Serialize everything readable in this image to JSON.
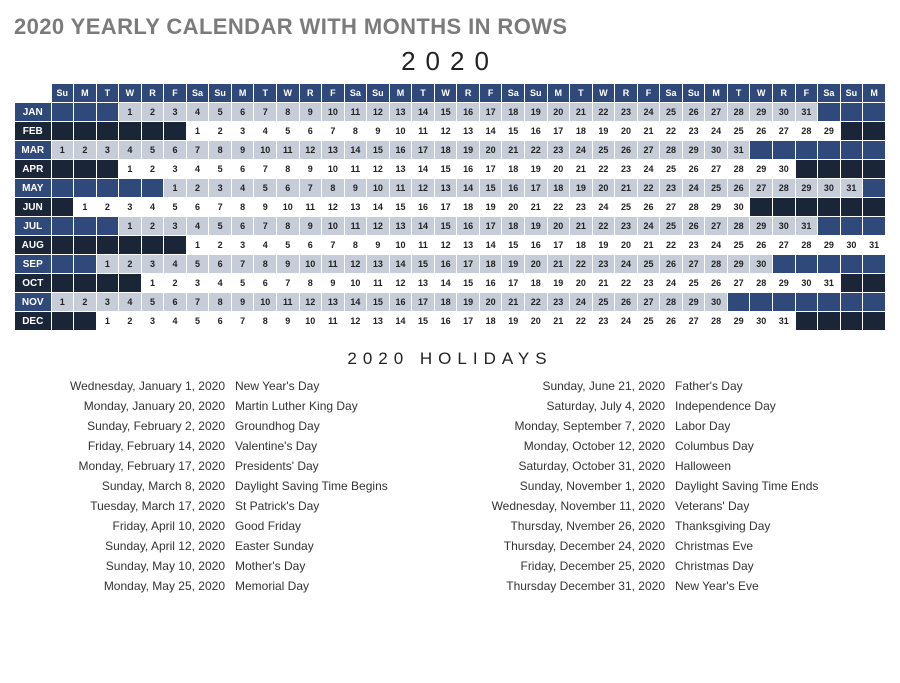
{
  "title": "2020 YEARLY CALENDAR WITH MONTHS IN ROWS",
  "year": "2020",
  "holidays_heading": "2020 HOLIDAYS",
  "dow": [
    "Su",
    "M",
    "T",
    "W",
    "R",
    "F",
    "Sa",
    "Su",
    "M",
    "T",
    "W",
    "R",
    "F",
    "Sa",
    "Su",
    "M",
    "T",
    "W",
    "R",
    "F",
    "Sa",
    "Su",
    "M",
    "T",
    "W",
    "R",
    "F",
    "Sa",
    "Su",
    "M",
    "T",
    "W",
    "R",
    "F",
    "Sa",
    "Su",
    "M"
  ],
  "months": [
    {
      "label": "JAN",
      "start": 3,
      "days": 31
    },
    {
      "label": "FEB",
      "start": 6,
      "days": 29
    },
    {
      "label": "MAR",
      "start": 0,
      "days": 31
    },
    {
      "label": "APR",
      "start": 3,
      "days": 30
    },
    {
      "label": "MAY",
      "start": 5,
      "days": 31
    },
    {
      "label": "JUN",
      "start": 1,
      "days": 30
    },
    {
      "label": "JUL",
      "start": 3,
      "days": 31
    },
    {
      "label": "AUG",
      "start": 6,
      "days": 31
    },
    {
      "label": "SEP",
      "start": 2,
      "days": 30
    },
    {
      "label": "OCT",
      "start": 4,
      "days": 31
    },
    {
      "label": "NOV",
      "start": 0,
      "days": 30
    },
    {
      "label": "DEC",
      "start": 2,
      "days": 31
    }
  ],
  "holidays_left": [
    {
      "date": "Wednesday, January 1, 2020",
      "name": "New Year's Day"
    },
    {
      "date": "Monday, January 20, 2020",
      "name": "Martin Luther King Day"
    },
    {
      "date": "Sunday, February 2, 2020",
      "name": "Groundhog Day"
    },
    {
      "date": "Friday, February 14, 2020",
      "name": "Valentine's Day"
    },
    {
      "date": "Monday, February 17, 2020",
      "name": "Presidents' Day"
    },
    {
      "date": "Sunday, March 8, 2020",
      "name": "Daylight Saving Time Begins"
    },
    {
      "date": "Tuesday, March 17, 2020",
      "name": "St Patrick's Day"
    },
    {
      "date": "Friday, April 10, 2020",
      "name": "Good Friday"
    },
    {
      "date": "Sunday, April 12, 2020",
      "name": "Easter Sunday"
    },
    {
      "date": "Sunday, May 10, 2020",
      "name": "Mother's Day"
    },
    {
      "date": "Monday, May 25, 2020",
      "name": "Memorial Day"
    }
  ],
  "holidays_right": [
    {
      "date": "Sunday, June 21, 2020",
      "name": "Father's Day"
    },
    {
      "date": "Saturday, July 4, 2020",
      "name": "Independence Day"
    },
    {
      "date": "Monday, September 7, 2020",
      "name": "Labor Day"
    },
    {
      "date": "Monday, October 12, 2020",
      "name": "Columbus Day"
    },
    {
      "date": "Saturday, October 31, 2020",
      "name": "Halloween"
    },
    {
      "date": "Sunday, November 1, 2020",
      "name": "Daylight Saving Time Ends"
    },
    {
      "date": "Wednesday, November 11, 2020",
      "name": "Veterans' Day"
    },
    {
      "date": "Thursday, Nvember 26, 2020",
      "name": "Thanksgiving Day"
    },
    {
      "date": "Thursday, December 24, 2020",
      "name": "Christmas Eve"
    },
    {
      "date": "Friday, December 25, 2020",
      "name": "Christmas Day"
    },
    {
      "date": "Thursday December 31, 2020",
      "name": "New Year's Eve"
    }
  ]
}
